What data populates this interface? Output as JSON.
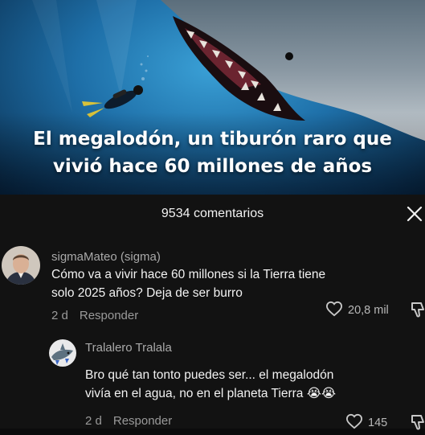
{
  "video": {
    "caption_line1": "El megalodón, un tiburón raro que",
    "caption_line2": "vivió hace 60 millones de años"
  },
  "comments_sheet": {
    "count_label": "9534 comentarios",
    "close_icon": "close-icon"
  },
  "comments": [
    {
      "username": "sigmaMateo (sigma)",
      "text_line1": "Cómo va a vivir hace 60 millones si la Tierra tiene",
      "text_line2": "solo 2025 años? Deja de ser burro",
      "time": "2 d",
      "reply_label": "Responder",
      "likes": "20,8 mil"
    },
    {
      "username": "Tralalero Tralala",
      "text_line1": "Bro qué tan tonto puedes ser... el megalodón",
      "text_line2": "vivía en el agua, no en el planeta Tierra 😭😭",
      "time": "2 d",
      "reply_label": "Responder",
      "likes": "145"
    }
  ],
  "colors": {
    "sheet_background": "#121212",
    "username": "#a9a9a9",
    "meta": "#9a9a9a"
  }
}
